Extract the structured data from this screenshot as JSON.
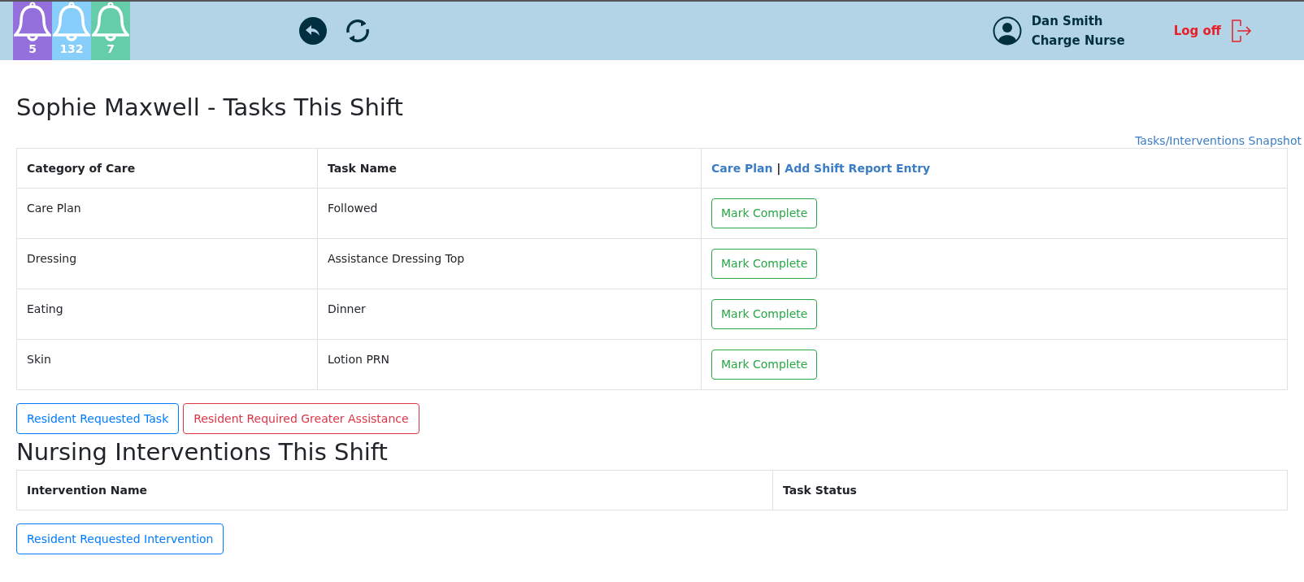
{
  "header": {
    "alerts": [
      {
        "count": "5",
        "color": "#9370db"
      },
      {
        "count": "132",
        "color": "#87cefa"
      },
      {
        "count": "7",
        "color": "#66cdaa"
      }
    ],
    "user": {
      "name": "Dan Smith",
      "role": "Charge Nurse"
    },
    "logoff": "Log off"
  },
  "tasks": {
    "title": "Sophie Maxwell - Tasks This Shift",
    "snapshot_link": "Tasks/Interventions Snapshot",
    "columns": [
      "Category of Care",
      "Task Name"
    ],
    "header_links": [
      "Care Plan",
      "Add Shift Report Entry"
    ],
    "header_separator": "|",
    "rows": [
      {
        "category": "Care Plan",
        "task": "Followed",
        "action": "Mark Complete"
      },
      {
        "category": "Dressing",
        "task": "Assistance Dressing Top",
        "action": "Mark Complete"
      },
      {
        "category": "Eating",
        "task": "Dinner",
        "action": "Mark Complete"
      },
      {
        "category": "Skin",
        "task": "Lotion PRN",
        "action": "Mark Complete"
      }
    ],
    "buttons": [
      {
        "label": "Resident Requested Task",
        "kind": "primary"
      },
      {
        "label": "Resident Required Greater Assistance",
        "kind": "danger"
      }
    ]
  },
  "interventions": {
    "title": "Nursing Interventions This Shift",
    "columns": [
      "Intervention Name",
      "Task Status"
    ],
    "buttons": [
      {
        "label": "Resident Requested Intervention",
        "kind": "primary"
      }
    ]
  }
}
